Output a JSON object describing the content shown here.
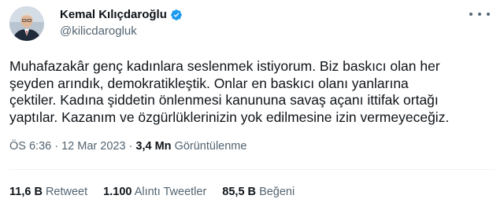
{
  "author": {
    "display_name": "Kemal Kılıçdaroğlu",
    "handle": "@kilicdarogluk",
    "verified": true
  },
  "tweet": {
    "lines": [
      "Muhafazakâr genç kadınlara seslenmek istiyorum. Biz baskıcı olan her",
      "şeyden arındık, demokratikleştik. Onlar en baskıcı olanı yanlarına",
      "çektiler. Kadına şiddetin önlenmesi kanununa savaş açanı ittifak ortağı",
      "yaptılar. Kazanım ve özgürlüklerinizin yok edilmesine izin vermeyeceğiz."
    ]
  },
  "meta": {
    "time": "ÖS 6:36",
    "separator": " · ",
    "date": "12 Mar 2023",
    "views_count": "3,4 Mn",
    "views_label": "Görüntülenme"
  },
  "stats": {
    "retweets_count": "11,6 B",
    "retweets_label": "Retweet",
    "quotes_count": "1.100",
    "quotes_label": "Alıntı Tweetler",
    "likes_count": "85,5 B",
    "likes_label": "Beğeni"
  },
  "colors": {
    "verified_badge": "#1d9bf0",
    "secondary_text": "#536471",
    "divider": "#eff3f4"
  },
  "icons": {
    "verified": "verified-badge-icon",
    "more": "more-options-icon"
  }
}
